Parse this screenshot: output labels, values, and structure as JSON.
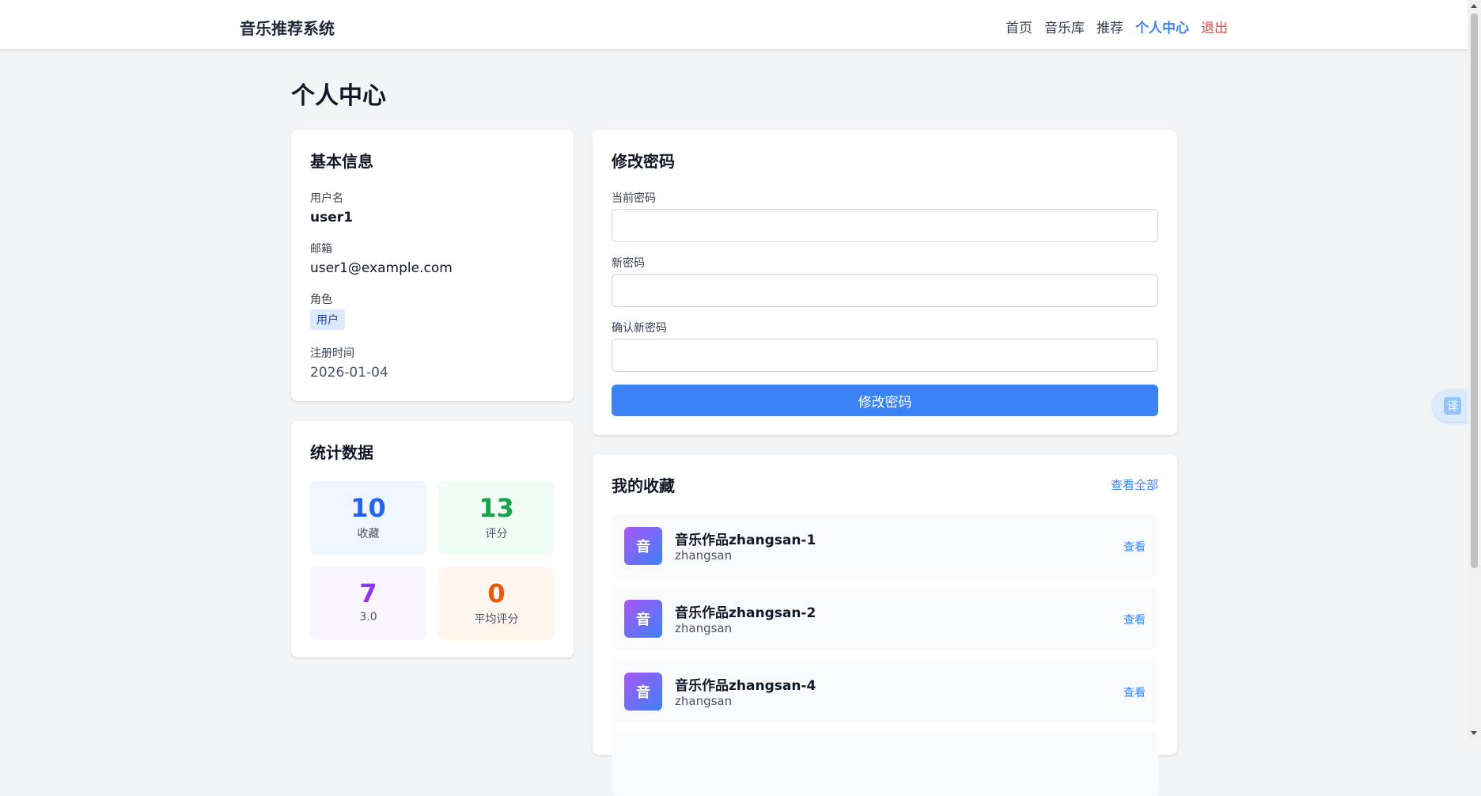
{
  "nav": {
    "brand": "音乐推荐系统",
    "links": [
      "首页",
      "音乐库",
      "推荐",
      "个人中心",
      "退出"
    ]
  },
  "page_title": "个人中心",
  "info": {
    "title": "基本信息",
    "username_label": "用户名",
    "username": "user1",
    "email_label": "邮箱",
    "email": "user1@example.com",
    "role_label": "角色",
    "role": "用户",
    "registered_label": "注册时间",
    "registered": "2026-01-04"
  },
  "stats": {
    "title": "统计数据",
    "items": [
      {
        "value": "10",
        "label": "收藏"
      },
      {
        "value": "13",
        "label": "评分"
      },
      {
        "value": "7",
        "label": "3.0"
      },
      {
        "value": "0",
        "label": "平均评分"
      }
    ]
  },
  "password": {
    "title": "修改密码",
    "current_label": "当前密码",
    "new_label": "新密码",
    "confirm_label": "确认新密码",
    "submit": "修改密码"
  },
  "favorites": {
    "title": "我的收藏",
    "view_all": "查看全部",
    "items": [
      {
        "cover": "音",
        "title": "音乐作品zhangsan-1",
        "artist": "zhangsan",
        "action": "查看"
      },
      {
        "cover": "音",
        "title": "音乐作品zhangsan-2",
        "artist": "zhangsan",
        "action": "查看"
      },
      {
        "cover": "音",
        "title": "音乐作品zhangsan-4",
        "artist": "zhangsan",
        "action": "查看"
      }
    ]
  },
  "translate_button": "译",
  "colors": {
    "primary": "#3b82f6",
    "danger": "#ef4444",
    "background": "#f3f4f6"
  }
}
